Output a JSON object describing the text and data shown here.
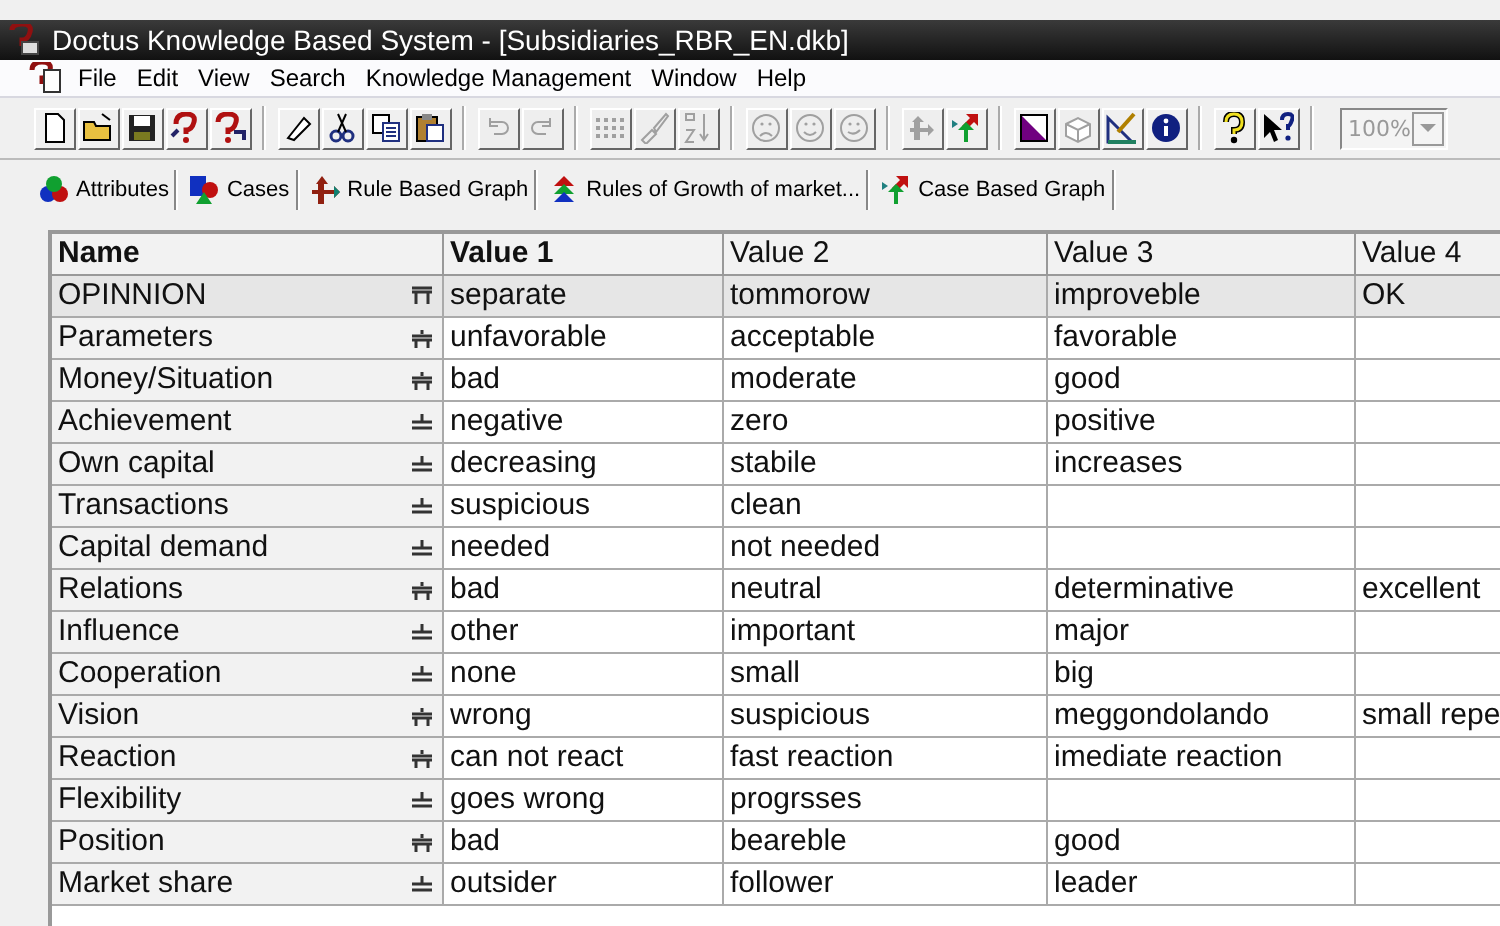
{
  "window": {
    "title": "Doctus Knowledge Based System - [Subsidiaries_RBR_EN.dkb]"
  },
  "menu": [
    "File",
    "Edit",
    "View",
    "Search",
    "Knowledge Management",
    "Window",
    "Help"
  ],
  "toolbar": {
    "groups": [
      [
        {
          "disabled": false
        },
        {
          "disabled": false
        },
        {
          "disabled": false
        },
        {
          "disabled": false
        },
        {
          "disabled": false
        }
      ],
      [
        {
          "disabled": false
        },
        {
          "disabled": false
        },
        {
          "disabled": false
        },
        {
          "disabled": false
        }
      ],
      [
        {
          "disabled": true
        },
        {
          "disabled": true
        }
      ],
      [
        {
          "disabled": true
        },
        {
          "disabled": true
        },
        {
          "disabled": true
        }
      ],
      [
        {
          "disabled": true
        },
        {
          "disabled": true
        },
        {
          "disabled": true
        }
      ],
      [
        {
          "disabled": true
        },
        {
          "disabled": false
        }
      ],
      [
        {
          "disabled": false
        },
        {
          "disabled": true
        },
        {
          "disabled": false
        },
        {
          "disabled": false
        }
      ],
      [
        {
          "disabled": false
        },
        {
          "disabled": false
        }
      ]
    ],
    "zoom": {
      "value": "100%",
      "disabled": true
    }
  },
  "tabs": [
    {
      "label": "Attributes"
    },
    {
      "label": "Cases"
    },
    {
      "label": "Rule Based Graph"
    },
    {
      "label": "Rules of Growth of market..."
    },
    {
      "label": "Case Based Graph"
    }
  ],
  "table": {
    "columns": [
      "Name",
      "Value 1",
      "Value 2",
      "Value 3",
      "Value 4"
    ],
    "rows": [
      {
        "name": "OPINNION",
        "kind": "root",
        "selected": true,
        "values": [
          "separate",
          "tommorow",
          "improveble",
          "OK"
        ]
      },
      {
        "name": "Parameters",
        "kind": "node",
        "selected": false,
        "values": [
          "unfavorable",
          "acceptable",
          "favorable"
        ]
      },
      {
        "name": "Money/Situation",
        "kind": "node",
        "selected": false,
        "values": [
          "bad",
          "moderate",
          "good"
        ]
      },
      {
        "name": "Achievement",
        "kind": "leaf",
        "selected": false,
        "values": [
          "negative",
          "zero",
          "positive"
        ]
      },
      {
        "name": "Own capital",
        "kind": "leaf",
        "selected": false,
        "values": [
          "decreasing",
          "stabile",
          "increases"
        ]
      },
      {
        "name": "Transactions",
        "kind": "leaf",
        "selected": false,
        "values": [
          "suspicious",
          "clean"
        ]
      },
      {
        "name": "Capital demand",
        "kind": "leaf",
        "selected": false,
        "values": [
          "needed",
          "not needed"
        ]
      },
      {
        "name": "Relations",
        "kind": "node",
        "selected": false,
        "values": [
          "bad",
          "neutral",
          "determinative",
          "excellent"
        ]
      },
      {
        "name": "Influence",
        "kind": "leaf",
        "selected": false,
        "values": [
          "other",
          "important",
          "major"
        ]
      },
      {
        "name": "Cooperation",
        "kind": "leaf",
        "selected": false,
        "values": [
          "none",
          "small",
          "big"
        ]
      },
      {
        "name": "Vision",
        "kind": "node",
        "selected": false,
        "values": [
          "wrong",
          "suspicious",
          "meggondolando",
          "small repe"
        ]
      },
      {
        "name": "Reaction",
        "kind": "node",
        "selected": false,
        "values": [
          "can not react",
          "fast reaction",
          "imediate reaction"
        ]
      },
      {
        "name": "Flexibility",
        "kind": "leaf",
        "selected": false,
        "values": [
          "goes wrong",
          "progrsses"
        ]
      },
      {
        "name": "Position",
        "kind": "node",
        "selected": false,
        "values": [
          "bad",
          "beareble",
          "good"
        ]
      },
      {
        "name": "Market share",
        "kind": "leaf",
        "selected": false,
        "values": [
          "outsider",
          "follower",
          "leader"
        ]
      }
    ]
  }
}
